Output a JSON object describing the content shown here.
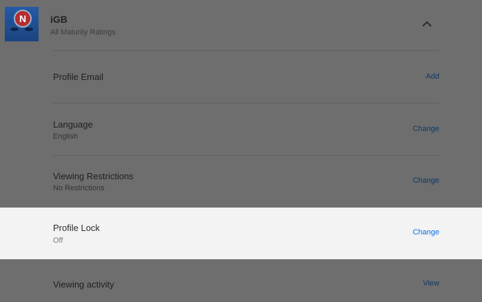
{
  "profile": {
    "avatar_letter": "N",
    "name": "iGB",
    "maturity": "All Maturity Ratings",
    "collapse_icon": "chevron-up-icon"
  },
  "settings": {
    "email": {
      "label": "Profile Email",
      "action": "Add"
    },
    "language": {
      "label": "Language",
      "value": "English",
      "action": "Change"
    },
    "restrictions": {
      "label": "Viewing Restrictions",
      "value": "No Restrictions",
      "action": "Change"
    },
    "lock": {
      "label": "Profile Lock",
      "value": "Off",
      "action": "Change"
    },
    "activity": {
      "label": "Viewing activity",
      "action": "View"
    }
  },
  "colors": {
    "overlay": "#6e6e6e",
    "highlight": "#f3f3f3",
    "link": "#0071eb"
  }
}
